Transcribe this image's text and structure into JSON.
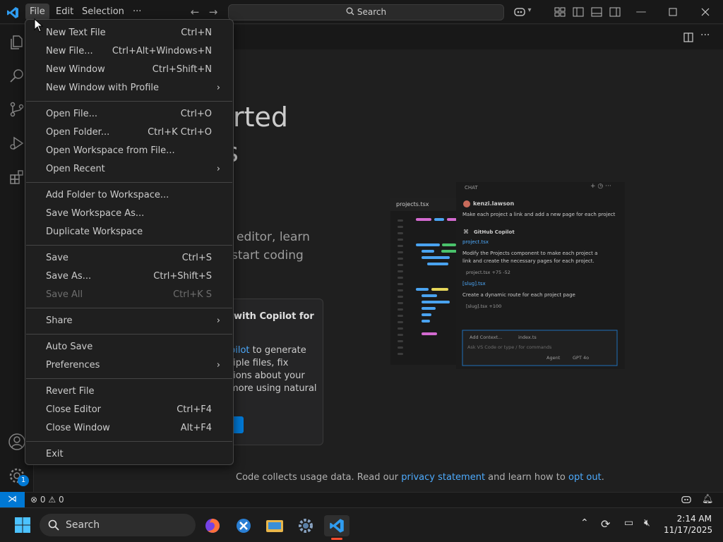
{
  "titlebar": {
    "menus": [
      "File",
      "Edit",
      "Selection"
    ],
    "more": "···",
    "search_placeholder": "Search"
  },
  "welcome": {
    "heading_part1": "rted",
    "heading_part2": "s",
    "desc_line1": "editor, learn",
    "desc_line2": "start coding",
    "card_title_1": "with Copilot for",
    "card_link": "pilot",
    "card_text_1": " to generate",
    "card_text_2": "tiple files, fix",
    "card_text_3": "tions about your",
    "card_text_4": "more using natural",
    "privacy_prefix": "Code collects usage data. Read our ",
    "privacy_link": "privacy statement",
    "privacy_mid": " and learn how to ",
    "optout_link": "opt out",
    "privacy_end": "."
  },
  "illustration": {
    "tab_label": "projects.tsx",
    "chat_title": "CHAT",
    "user": "kenzi.lawson",
    "user_msg": "Make each project a link and add a new page for each project",
    "assistant": "GitHub Copilot",
    "file1": "project.tsx",
    "msg2_line1": "Modify the Projects component to make each project a",
    "msg2_line2": "link and create the necessary pages for each project.",
    "file1_diff": "project.tsx +75 -52",
    "file2": "[slug].tsx",
    "msg3": "Create a dynamic route for each project page",
    "file2_diff": "[slug].tsx +100",
    "add_context": "Add Context...",
    "index_file": "index.ts",
    "input_placeholder": "Ask VS Code or type / for commands",
    "mode": "Agent",
    "model": "GPT 4o"
  },
  "file_menu": {
    "groups": [
      [
        {
          "label": "New Text File",
          "shortcut": "Ctrl+N"
        },
        {
          "label": "New File...",
          "shortcut": "Ctrl+Alt+Windows+N"
        },
        {
          "label": "New Window",
          "shortcut": "Ctrl+Shift+N"
        },
        {
          "label": "New Window with Profile",
          "submenu": true
        }
      ],
      [
        {
          "label": "Open File...",
          "shortcut": "Ctrl+O"
        },
        {
          "label": "Open Folder...",
          "shortcut": "Ctrl+K Ctrl+O"
        },
        {
          "label": "Open Workspace from File..."
        },
        {
          "label": "Open Recent",
          "submenu": true
        }
      ],
      [
        {
          "label": "Add Folder to Workspace..."
        },
        {
          "label": "Save Workspace As..."
        },
        {
          "label": "Duplicate Workspace"
        }
      ],
      [
        {
          "label": "Save",
          "shortcut": "Ctrl+S"
        },
        {
          "label": "Save As...",
          "shortcut": "Ctrl+Shift+S"
        },
        {
          "label": "Save All",
          "shortcut": "Ctrl+K S",
          "disabled": true
        }
      ],
      [
        {
          "label": "Share",
          "submenu": true
        }
      ],
      [
        {
          "label": "Auto Save"
        },
        {
          "label": "Preferences",
          "submenu": true
        }
      ],
      [
        {
          "label": "Revert File"
        },
        {
          "label": "Close Editor",
          "shortcut": "Ctrl+F4"
        },
        {
          "label": "Close Window",
          "shortcut": "Alt+F4"
        }
      ],
      [
        {
          "label": "Exit"
        }
      ]
    ]
  },
  "statusbar": {
    "errors": "0",
    "warnings": "0"
  },
  "taskbar": {
    "search": "Search",
    "time": "2:14 AM",
    "date": "11/17/2025"
  },
  "badges": {
    "settings": "1"
  },
  "colors": {
    "accent": "#0078d4",
    "link": "#4daafc",
    "menu_bg": "#1f1f1f"
  }
}
